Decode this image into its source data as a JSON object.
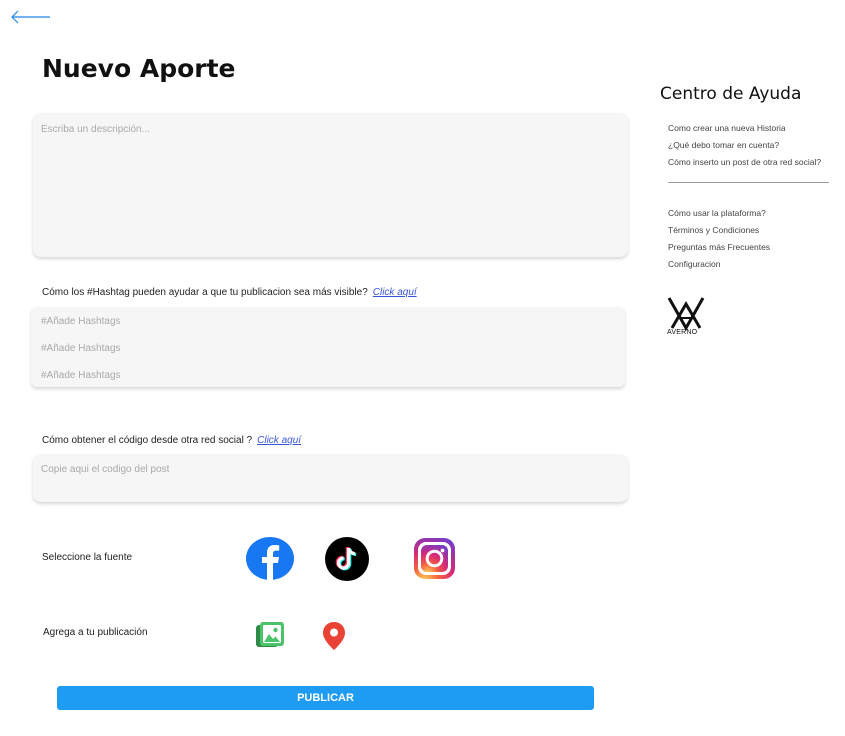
{
  "header": {
    "back_icon": "back-arrow-icon",
    "title": "Nuevo Aporte"
  },
  "form": {
    "description_placeholder": "Escriba un descripción...",
    "hashtag_question": "Cómo los #Hashtag pueden ayudar a que tu publicacion sea más visible?",
    "hashtag_link": "Click aquí",
    "hashtag_placeholders": [
      "#Añade Hashtags",
      "#Añade Hashtags",
      "#Añade Hashtags"
    ],
    "code_question": "Cómo obtener el código desde otra red social ?",
    "code_link": "Click aquí",
    "code_placeholder": "Copie aqui el codigo del post",
    "source_label": "Seleccione la fuente",
    "sources": [
      "facebook-icon",
      "tiktok-icon",
      "instagram-icon"
    ],
    "add_label": "Agrega a tu publicación",
    "attachments": [
      "image-gallery-icon",
      "location-pin-icon"
    ],
    "publish_label": "PUBLICAR"
  },
  "help": {
    "title": "Centro de Ayuda",
    "links_top": [
      "Como crear una nueva Historia",
      "¿Qué debo tomar en cuenta?",
      "Cómo inserto un post de otra red social?"
    ],
    "links_bottom": [
      "Cómo usar la plataforma?",
      "Términos y Condiciones",
      "Preguntas más Frecuentes",
      "Configuracion"
    ],
    "logo_text": "AVERNO"
  },
  "colors": {
    "accent": "#1e9cf3",
    "link": "#3a56d8",
    "card": "#f6f6f6",
    "facebook": "#1877f2",
    "location": "#ea4335",
    "gallery": "#34a853"
  }
}
